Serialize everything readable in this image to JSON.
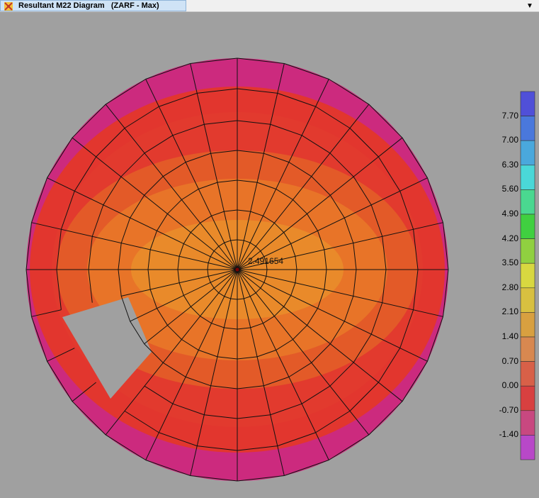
{
  "window": {
    "title": "Resultant M22 Diagram   (ZARF - Max)",
    "app_icon": "sap-app-icon",
    "dropdown_icon": "chevron-down-icon"
  },
  "plot": {
    "center_value_label": "2.491654",
    "quantity": "Resultant M22"
  },
  "legend": {
    "labels": [
      "7.70",
      "7.00",
      "6.30",
      "5.60",
      "4.90",
      "4.20",
      "3.50",
      "2.80",
      "2.10",
      "1.40",
      "0.70",
      "0.00",
      "-0.70",
      "-1.40"
    ],
    "colors": [
      "#5050d8",
      "#4a78dc",
      "#4aa8dc",
      "#4ad8d8",
      "#4ad890",
      "#40d040",
      "#90d040",
      "#d8d840",
      "#d8c040",
      "#d8a040",
      "#d88850",
      "#d86048",
      "#d84040",
      "#c84880",
      "#b848c8"
    ]
  },
  "colors": {
    "background": "#a0a0a0",
    "tab_active": "#cfe3f6",
    "mesh_line": "#111111",
    "outer_ring": "#cc2a7e",
    "red": "#e2362e",
    "orange_red": "#e35a28",
    "orange": "#e87428",
    "light_orange": "#e98a2a"
  }
}
